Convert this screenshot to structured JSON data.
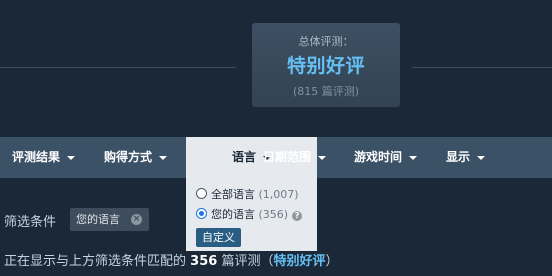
{
  "summary": {
    "label": "总体评测：",
    "score": "特别好评",
    "count": "(815 篇评测)"
  },
  "filter_tabs": [
    {
      "label": "评测结果"
    },
    {
      "label": "购得方式"
    },
    {
      "label": "语言"
    },
    {
      "label": "日期范围"
    },
    {
      "label": "游戏时间"
    },
    {
      "label": "显示"
    }
  ],
  "language_dropdown": {
    "options": [
      {
        "label": "全部语言",
        "count": "(1,007)",
        "selected": false
      },
      {
        "label": "您的语言",
        "count": "(356)",
        "selected": true
      }
    ],
    "help_icon": "?",
    "custom_button": "自定义"
  },
  "active_filters": {
    "label": "筛选条件",
    "chips": [
      {
        "label": "您的语言",
        "remove_icon": "×"
      }
    ]
  },
  "status": {
    "prefix": "正在显示与上方筛选条件匹配的",
    "count": "356",
    "middle": "篇评测（",
    "rating": "特别好评",
    "suffix": "）"
  },
  "colors": {
    "background": "#1b2838",
    "accent": "#66c0f4",
    "filter_bar": "#3b5166",
    "dropdown_bg": "#e6eaee",
    "button": "#2a5d83"
  }
}
